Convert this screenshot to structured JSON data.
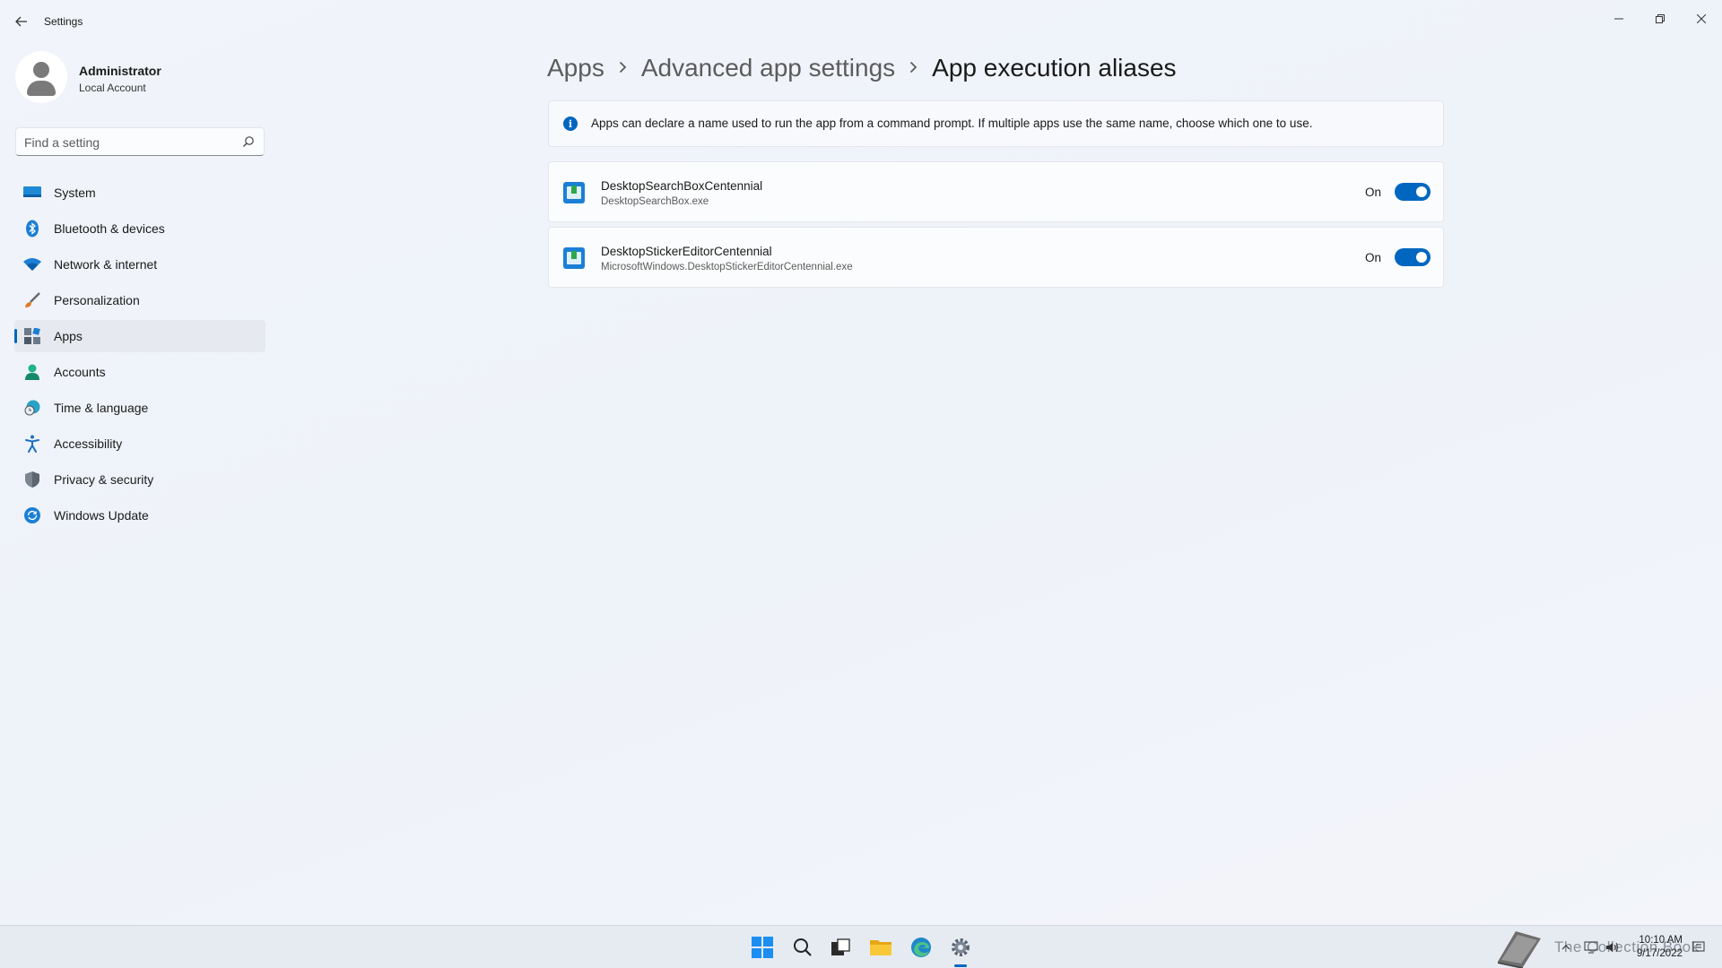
{
  "window": {
    "title": "Settings"
  },
  "user": {
    "name": "Administrator",
    "account_type": "Local Account"
  },
  "search": {
    "placeholder": "Find a setting"
  },
  "sidebar": {
    "items": [
      {
        "label": "System",
        "icon": "monitor-icon",
        "selected": false
      },
      {
        "label": "Bluetooth & devices",
        "icon": "bluetooth-icon",
        "selected": false
      },
      {
        "label": "Network & internet",
        "icon": "wifi-icon",
        "selected": false
      },
      {
        "label": "Personalization",
        "icon": "brush-icon",
        "selected": false
      },
      {
        "label": "Apps",
        "icon": "apps-icon",
        "selected": true
      },
      {
        "label": "Accounts",
        "icon": "person-icon",
        "selected": false
      },
      {
        "label": "Time & language",
        "icon": "globe-clock-icon",
        "selected": false
      },
      {
        "label": "Accessibility",
        "icon": "accessibility-icon",
        "selected": false
      },
      {
        "label": "Privacy & security",
        "icon": "shield-icon",
        "selected": false
      },
      {
        "label": "Windows Update",
        "icon": "refresh-icon",
        "selected": false
      }
    ]
  },
  "breadcrumb": {
    "items": [
      "Apps",
      "Advanced app settings"
    ],
    "current": "App execution aliases"
  },
  "info": {
    "text": "Apps can declare a name used to run the app from a command prompt. If multiple apps use the same name, choose which one to use."
  },
  "aliases": [
    {
      "name": "DesktopSearchBoxCentennial",
      "exe": "DesktopSearchBox.exe",
      "state_label": "On",
      "enabled": true
    },
    {
      "name": "DesktopStickerEditorCentennial",
      "exe": "MicrosoftWindows.DesktopStickerEditorCentennial.exe",
      "state_label": "On",
      "enabled": true
    }
  ],
  "taskbar": {
    "apps": [
      "start-icon",
      "search-icon",
      "task-view-icon",
      "file-explorer-icon",
      "edge-icon",
      "settings-icon"
    ],
    "active_app": "settings-icon",
    "time": "10:10 AM",
    "date": "9/17/2022",
    "watermark_text": "The Collection Book"
  },
  "colors": {
    "accent": "#0067c0",
    "background": "#eef2f8"
  }
}
